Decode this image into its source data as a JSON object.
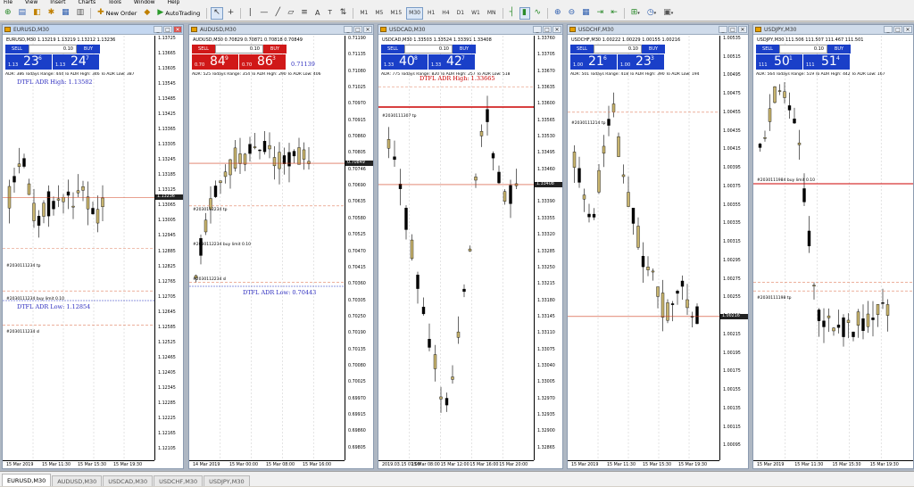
{
  "menu": [
    "File",
    "View",
    "Insert",
    "Charts",
    "Tools",
    "Window",
    "Help"
  ],
  "toolbar": {
    "new_order": "New Order",
    "autotrading": "AutoTrading",
    "timeframes": [
      "M1",
      "M5",
      "M15",
      "M30",
      "H1",
      "H4",
      "D1",
      "W1",
      "MN"
    ],
    "selected_timeframe": "M30"
  },
  "tabs": [
    "EURUSD,M30",
    "AUDUSD,M30",
    "USDCAD,M30",
    "USDCHF,M30",
    "USDJPY,M30"
  ],
  "active_tab": "EURUSD,M30",
  "colors": {
    "sell": "#1a3fc8",
    "buy": "#1a3fc8",
    "sell_red": "#d01818",
    "bull": "#c8b46e",
    "bear": "#000000",
    "adr_line": "#c00000"
  },
  "windows": [
    {
      "title": "EURUSD,M30",
      "symbol_line": "EURUSD,M30  1.13219 1.13219 1.13212 1.13236",
      "sell": "SELL",
      "buy": "BUY",
      "lot": "0.10",
      "bid_small": "1.13",
      "bid_big": "23",
      "bid_sup": "6",
      "ask_small": "1.13",
      "ask_big": "24",
      "ask_sup": "7",
      "red": false,
      "adr": "ADR: 386  Todays Range: 444  To ADR High: 346  To ADR Low: 387",
      "adr_high": "DTFL ADR High: 1.13582",
      "adr_low": "DTFL ADR Low: 1.12854",
      "orders": [
        "#2030111234 tp",
        "#2030111234 buy limit 0.10",
        "#2030111234 sl"
      ],
      "yticks": [
        "1.13725",
        "1.13665",
        "1.13605",
        "1.13545",
        "1.13485",
        "1.13425",
        "1.13365",
        "1.13305",
        "1.13245",
        "1.13185",
        "1.13125",
        "1.13065",
        "1.13005",
        "1.12945",
        "1.12885",
        "1.12825",
        "1.12765",
        "1.12705",
        "1.12645",
        "1.12585",
        "1.12525",
        "1.12465",
        "1.12405",
        "1.12345",
        "1.12285",
        "1.12225",
        "1.12165",
        "1.12105"
      ],
      "price_tag": "1.13236",
      "xticks": [
        "15 Mar 2019",
        "15 Mar 11:30",
        "15 Mar 15:30",
        "15 Mar 19:30"
      ]
    },
    {
      "title": "AUDUSD,M30",
      "symbol_line": "AUDUSD,M30  0.70829 0.70871 0.70818 0.70849",
      "sell": "SELL",
      "buy": "BUY",
      "lot": "0.10",
      "bid_small": "0.70",
      "bid_big": "84",
      "bid_sup": "9",
      "ask_small": "0.70",
      "ask_big": "86",
      "ask_sup": "3",
      "red": true,
      "adr": "ADR: 525  Todays Range: 354  To ADR High: 290  To ADR Low: 406",
      "adr_high": "0.71139",
      "adr_low": "DTFL ADR Low: 0.70443",
      "orders": [
        "#2030112234 tp",
        "#2030112234 buy limit 0.10",
        "#2030112234 sl"
      ],
      "yticks": [
        "0.71190",
        "0.71135",
        "0.71080",
        "0.71025",
        "0.70970",
        "0.70915",
        "0.70860",
        "0.70805",
        "0.70746",
        "0.70690",
        "0.70635",
        "0.70580",
        "0.70525",
        "0.70470",
        "0.70415",
        "0.70360",
        "0.70305",
        "0.70250",
        "0.70190",
        "0.70135",
        "0.70080",
        "0.70025",
        "0.69970",
        "0.69915",
        "0.69860",
        "0.69805"
      ],
      "price_tag": "0.70849",
      "xticks": [
        "14 Mar 2019",
        "15 Mar 00:00",
        "15 Mar 08:00",
        "15 Mar 16:00"
      ]
    },
    {
      "title": "USDCAD,M30",
      "symbol_line": "USDCAD,M30  1.33503 1.33524 1.33391 1.33408",
      "sell": "SELL",
      "buy": "BUY",
      "lot": "0.10",
      "bid_small": "1.33",
      "bid_big": "40",
      "bid_sup": "8",
      "ask_small": "1.33",
      "ask_big": "42",
      "ask_sup": "7",
      "red": false,
      "adr": "ADR: 775  Todays Range: 820  To ADR High: 257  To ADR Low: 518",
      "adr_high": "DTFL ADR High: 1.33665",
      "adr_low": "DTFL ADR Low: 1.32890",
      "orders": [
        "#2030111307 tp"
      ],
      "yticks": [
        "1.33760",
        "1.33705",
        "1.33670",
        "1.33635",
        "1.33600",
        "1.33565",
        "1.33530",
        "1.33495",
        "1.33460",
        "1.33425",
        "1.33390",
        "1.33355",
        "1.33320",
        "1.33285",
        "1.33250",
        "1.33215",
        "1.33180",
        "1.33145",
        "1.33110",
        "1.33075",
        "1.33040",
        "1.33005",
        "1.32970",
        "1.32935",
        "1.32900",
        "1.32865"
      ],
      "price_tag": "1.33408",
      "xticks": [
        "2019.03.15 07:00",
        "15 Mar 08:00",
        "15 Mar 12:00",
        "15 Mar 16:00",
        "15 Mar 20:00"
      ]
    },
    {
      "title": "USDCHF,M30",
      "symbol_line": "USDCHF,M30  1.00222 1.00229 1.00155 1.00216",
      "sell": "SELL",
      "buy": "BUY",
      "lot": "0.10",
      "bid_small": "1.00",
      "bid_big": "21",
      "bid_sup": "6",
      "ask_small": "1.00",
      "ask_big": "23",
      "ask_sup": "3",
      "red": false,
      "adr": "ADR: 501  Todays Range: 418  To ADR High: 390  To ADR Low: 194",
      "adr_high": "",
      "adr_low": "",
      "orders": [
        "#2030111214 tp"
      ],
      "yticks": [
        "1.00535",
        "1.00515",
        "1.00495",
        "1.00475",
        "1.00455",
        "1.00435",
        "1.00415",
        "1.00395",
        "1.00375",
        "1.00355",
        "1.00335",
        "1.00315",
        "1.00295",
        "1.00275",
        "1.00255",
        "1.00235",
        "1.00215",
        "1.00195",
        "1.00175",
        "1.00155",
        "1.00135",
        "1.00115",
        "1.00095"
      ],
      "price_tag": "1.00216",
      "xticks": [
        "15 Mar 2019",
        "15 Mar 11:30",
        "15 Mar 15:30",
        "15 Mar 19:30"
      ]
    },
    {
      "title": "USDJPY,M30",
      "symbol_line": "USDJPY,M30  111.506 111.507 111.467 111.501",
      "sell": "SELL",
      "buy": "BUY",
      "lot": "0.10",
      "bid_small": "111",
      "bid_big": "50",
      "bid_sup": "1",
      "ask_small": "111",
      "ask_big": "51",
      "ask_sup": "4",
      "red": false,
      "adr": "ADR: 564  Todays Range: 519  To ADR High: 442  To ADR Low: 167",
      "adr_high": "",
      "adr_low": "",
      "orders": [
        "#2030111984 buy limit 0.10",
        "#2030111198 tp"
      ],
      "yticks": [],
      "price_tag": "",
      "xticks": [
        "15 Mar 2019",
        "15 Mar 11:30",
        "15 Mar 15:30",
        "15 Mar 19:30"
      ]
    }
  ]
}
